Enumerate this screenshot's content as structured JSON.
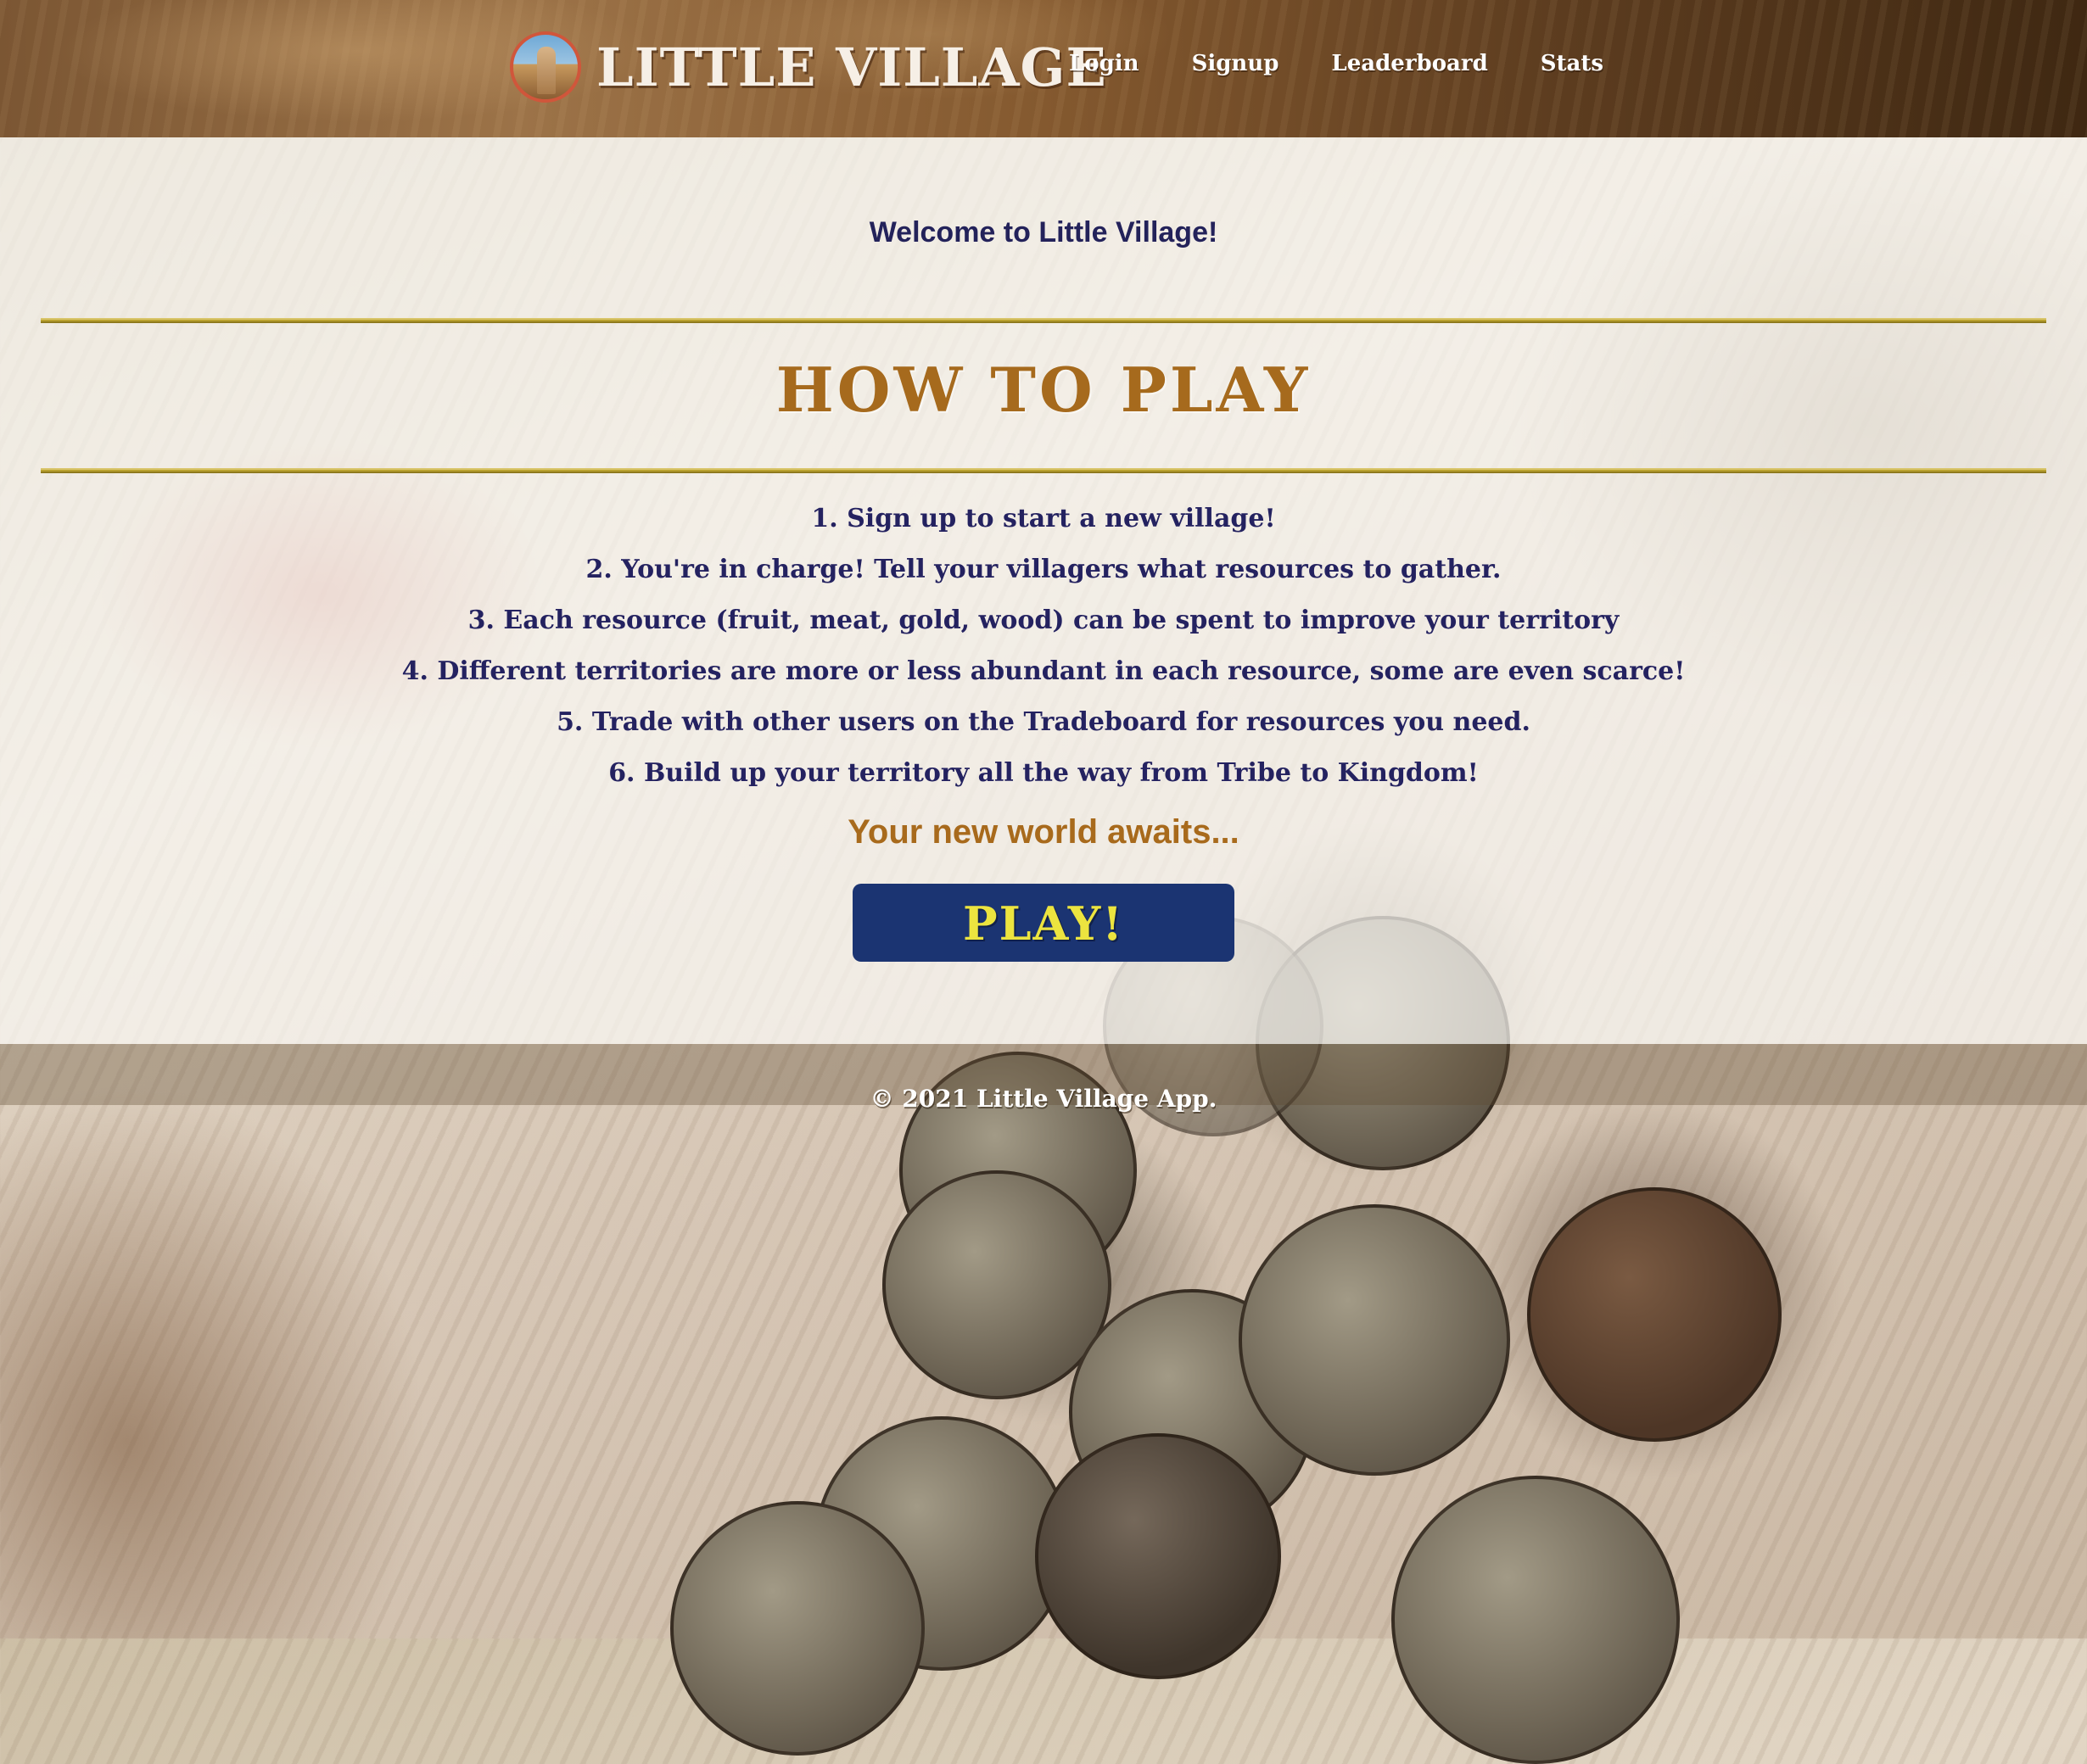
{
  "header": {
    "brand_title": "LITTLE VILLAGE",
    "nav": [
      {
        "label": "Login"
      },
      {
        "label": "Signup"
      },
      {
        "label": "Leaderboard"
      },
      {
        "label": "Stats"
      }
    ]
  },
  "main": {
    "welcome": "Welcome to Little Village!",
    "heading": "HOW TO PLAY",
    "steps": [
      "1. Sign up to start a new village!",
      "2. You're in charge! Tell your villagers what resources to gather.",
      "3. Each resource (fruit, meat, gold, wood) can be spent to improve your territory",
      "4. Different territories are more or less abundant in each resource, some are even scarce!",
      "5. Trade with other users on the Tradeboard for resources you need.",
      "6. Build up your territory all the way from Tribe to Kingdom!"
    ],
    "tagline": "Your new world awaits...",
    "play_label": "PLAY!"
  },
  "footer": {
    "copyright": "© 2021 Little Village App."
  },
  "colors": {
    "header_bg": "#7b5633",
    "heading": "#a66a1d",
    "text": "#242260",
    "button_bg": "#1b3472",
    "button_text": "#ece43f",
    "rule": "#b9a12f"
  },
  "icons": {
    "logo": "village-tower-logo-icon"
  }
}
